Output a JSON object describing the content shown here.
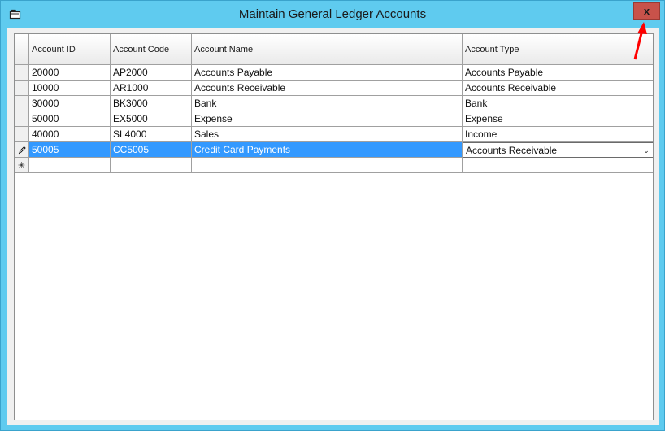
{
  "window": {
    "title": "Maintain General Ledger Accounts",
    "close_label": "x",
    "colors": {
      "frame": "#5fcbef",
      "close": "#c8524a",
      "selection": "#3399ff",
      "annotation_arrow": "#ff0000"
    }
  },
  "grid": {
    "columns": [
      "Account ID",
      "Account Code",
      "Account Name",
      "Account Type"
    ],
    "rows": [
      [
        "20000",
        "AP2000",
        "Accounts Payable",
        "Accounts Payable"
      ],
      [
        "10000",
        "AR1000",
        "Accounts Receivable",
        "Accounts Receivable"
      ],
      [
        "30000",
        "BK3000",
        "Bank",
        "Bank"
      ],
      [
        "50000",
        "EX5000",
        "Expense",
        "Expense"
      ],
      [
        "40000",
        "SL4000",
        "Sales",
        "Income"
      ],
      [
        "50005",
        "CC5005",
        "Credit Card Payments",
        "Accounts Receivable"
      ]
    ],
    "editing_row_icon": "pencil-icon",
    "new_row_icon": "asterisk-icon",
    "new_row_glyph": "✳",
    "dropdown_icon": "chevron-down-icon",
    "dropdown_glyph": "⌄"
  }
}
